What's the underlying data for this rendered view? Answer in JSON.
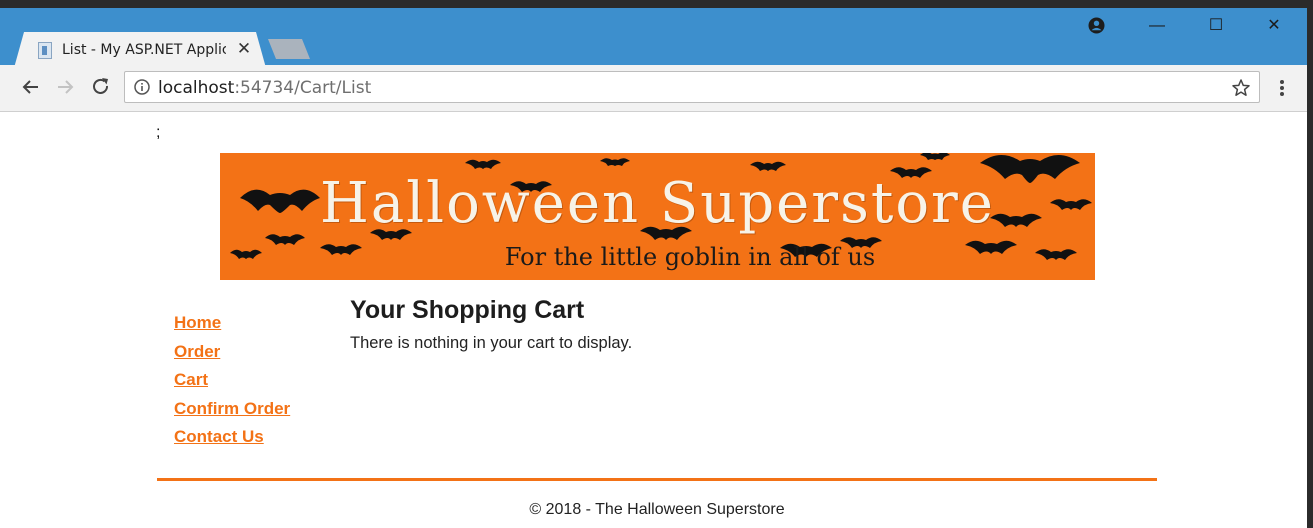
{
  "browser": {
    "tab_title": "List - My ASP.NET Applic",
    "tab_close": "✕",
    "window_controls": {
      "minimize": "—",
      "maximize": "☐",
      "close": "✕"
    },
    "url_host": "localhost",
    "url_rest": ":54734/Cart/List",
    "icons": [
      "back-arrow-icon",
      "forward-arrow-icon",
      "reload-icon",
      "info-icon",
      "star-icon",
      "menu-icon",
      "profile-icon",
      "page-favicon"
    ]
  },
  "page": {
    "stray_text": ";",
    "banner": {
      "title": "Halloween Superstore",
      "subtitle": "For the little goblin in all of us"
    },
    "nav": [
      {
        "label": "Home"
      },
      {
        "label": "Order"
      },
      {
        "label": "Cart"
      },
      {
        "label": "Confirm Order"
      },
      {
        "label": "Contact Us"
      }
    ],
    "main": {
      "heading": "Your Shopping Cart",
      "message": "There is nothing in your cart to display."
    },
    "footer": "© 2018 - The Halloween Superstore"
  },
  "colors": {
    "accent": "#f37216",
    "titlebar": "#3d8fcd",
    "toolbar": "#f2f2f2"
  }
}
